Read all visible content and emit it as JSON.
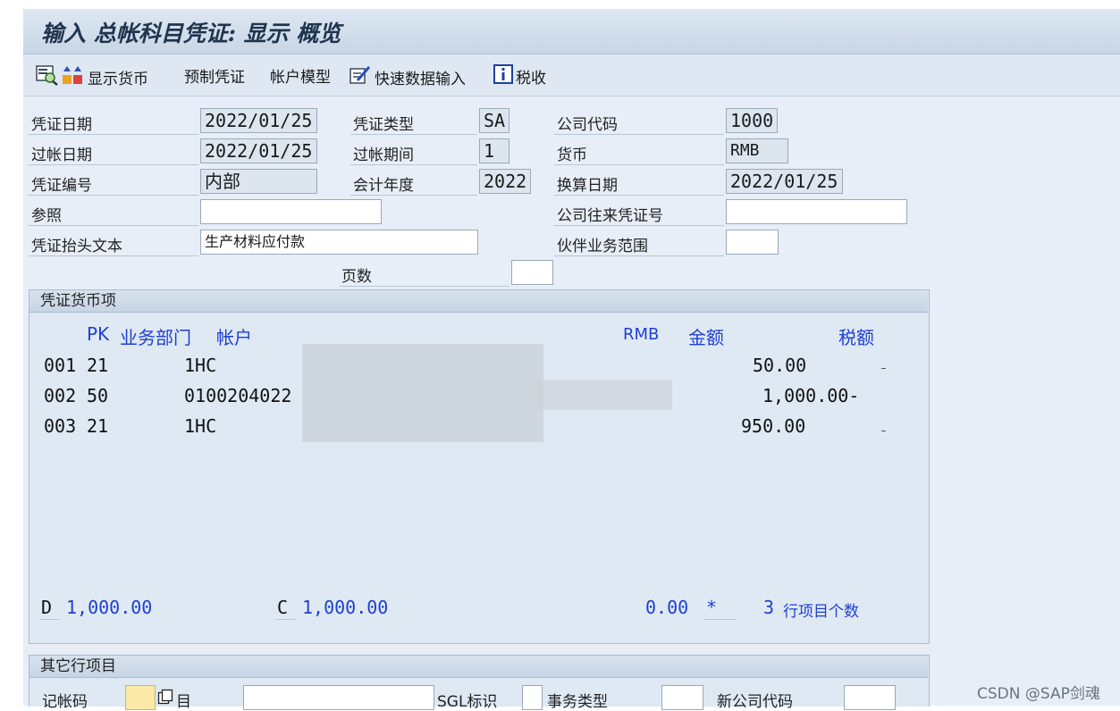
{
  "window": {
    "title": "输入 总帐科目凭证: 显示 概览"
  },
  "toolbar": {
    "show_currency": "显示货币",
    "park_document": "预制凭证",
    "account_model": "帐户模型",
    "fast_entry": "快速数据输入",
    "tax": "税收"
  },
  "header": {
    "doc_date_label": "凭证日期",
    "doc_date": "2022/01/25",
    "doc_type_label": "凭证类型",
    "doc_type": "SA",
    "company_code_label": "公司代码",
    "company_code": "1000",
    "posting_date_label": "过帐日期",
    "posting_date": "2022/01/25",
    "period_label": "过帐期间",
    "period": "1",
    "currency_label": "货币",
    "currency": "RMB",
    "doc_number_label": "凭证编号",
    "doc_number": "内部",
    "fiscal_year_label": "会计年度",
    "fiscal_year": "2022",
    "translation_date_label": "换算日期",
    "translation_date": "2022/01/25",
    "reference_label": "参照",
    "reference": "",
    "intercompany_label": "公司往来凭证号",
    "intercompany": "",
    "header_text_label": "凭证抬头文本",
    "header_text": "生产材料应付款",
    "trading_partner_label": "伙伴业务范围",
    "trading_partner": "",
    "pages_label": "页数",
    "pages": ""
  },
  "items": {
    "group_title": "凭证货币项",
    "col_pk": "PK",
    "col_bus_area": "业务部门",
    "col_account": "帐户",
    "col_currency": "RMB",
    "col_amount": "金额",
    "col_tax": "税额",
    "rows": [
      {
        "no": "001",
        "pk": "21",
        "account": "1HC",
        "amount": "50.00"
      },
      {
        "no": "002",
        "pk": "50",
        "account": "0100204022",
        "amount": "1,000.00-"
      },
      {
        "no": "003",
        "pk": "21",
        "account": "1HC",
        "amount": "950.00"
      }
    ],
    "debit_label": "D",
    "debit_total": "1,000.00",
    "credit_label": "C",
    "credit_total": "1,000.00",
    "balance": "0.00",
    "balance_flag": "*",
    "line_count": "3",
    "line_count_label": "行项目个数"
  },
  "other": {
    "group_title": "其它行项目",
    "posting_key_label": "记帐码",
    "account_label": "目",
    "sgl_label": "SGL标识",
    "trans_type_label": "事务类型",
    "new_company_label": "新公司代码"
  },
  "watermark": "CSDN @SAP剑魂"
}
